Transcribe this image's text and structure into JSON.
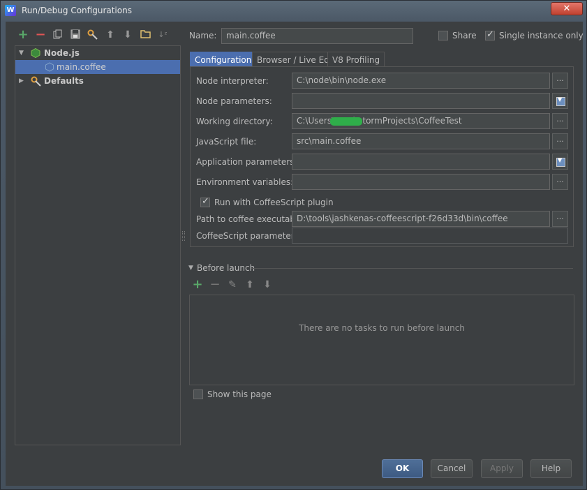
{
  "window": {
    "title": "Run/Debug Configurations",
    "app_icon_label": "W",
    "close_label": "✕"
  },
  "toolbar": {
    "icons": [
      "add-icon",
      "remove-icon",
      "copy-icon",
      "save-icon",
      "edit-defaults-icon",
      "move-up-icon",
      "move-down-icon",
      "folder-icon",
      "sort-icon"
    ]
  },
  "tree": {
    "group_label": "Node.js",
    "child_label": "main.coffee",
    "defaults_label": "Defaults"
  },
  "name_row": {
    "label": "Name:",
    "value": "main.coffee",
    "share_label": "Share",
    "share_checked": false,
    "single_label": "Single instance only",
    "single_checked": true
  },
  "tabs": [
    "Configuration",
    "Browser / Live Edit",
    "V8 Profiling"
  ],
  "form": {
    "node_interpreter_label": "Node interpreter:",
    "node_interpreter_value": "C:\\node\\bin\\node.exe",
    "node_params_label": "Node parameters:",
    "node_params_value": "",
    "working_dir_label": "Working directory:",
    "working_dir_value": "C:\\Users\\        \\WebstormProjects\\CoffeeTest",
    "js_file_label": "JavaScript file:",
    "js_file_value": "src\\main.coffee",
    "app_params_label": "Application parameters:",
    "app_params_value": "",
    "env_vars_label": "Environment variables:",
    "env_vars_value": "",
    "run_coffee_label": "Run with CoffeeScript plugin",
    "run_coffee_checked": true,
    "coffee_path_label": "Path to coffee executable:",
    "coffee_path_value": "D:\\tools\\jashkenas-coffeescript-f26d33d\\bin\\coffee",
    "coffee_params_label": "CoffeeScript parameters:",
    "coffee_params_value": "",
    "browse_label": "..."
  },
  "before_launch": {
    "title": "Before launch",
    "empty_message": "There are no tasks to run before launch",
    "show_page_label": "Show this page",
    "show_page_checked": false
  },
  "buttons": {
    "ok": "OK",
    "cancel": "Cancel",
    "apply": "Apply",
    "help": "Help"
  },
  "colors": {
    "selection": "#4b6eaf",
    "background": "#3c3f41",
    "add_green": "#59a869",
    "remove_red": "#e05555"
  }
}
